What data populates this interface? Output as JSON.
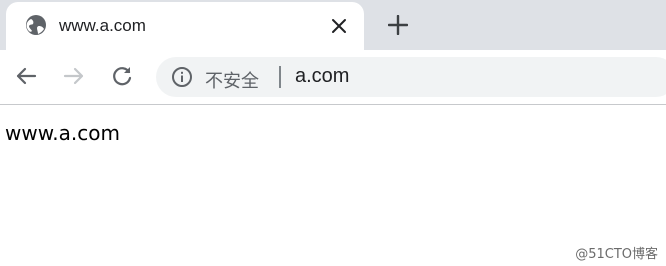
{
  "tab": {
    "title": "www.a.com",
    "favicon": "globe-icon",
    "close_icon": "close-icon"
  },
  "new_tab_icon": "plus-icon",
  "toolbar": {
    "back_icon": "arrow-left-icon",
    "forward_icon": "arrow-right-icon",
    "reload_icon": "reload-icon"
  },
  "omnibox": {
    "info_icon": "info-icon",
    "security_label": "不安全",
    "url": "a.com"
  },
  "page": {
    "body_text": "www.a.com"
  },
  "watermark": "@51CTO博客",
  "colors": {
    "tabstrip_bg": "#dee1e6",
    "omnibox_bg": "#f1f3f4",
    "icon_gray": "#5f6368",
    "disabled_gray": "#c4c7ca"
  }
}
